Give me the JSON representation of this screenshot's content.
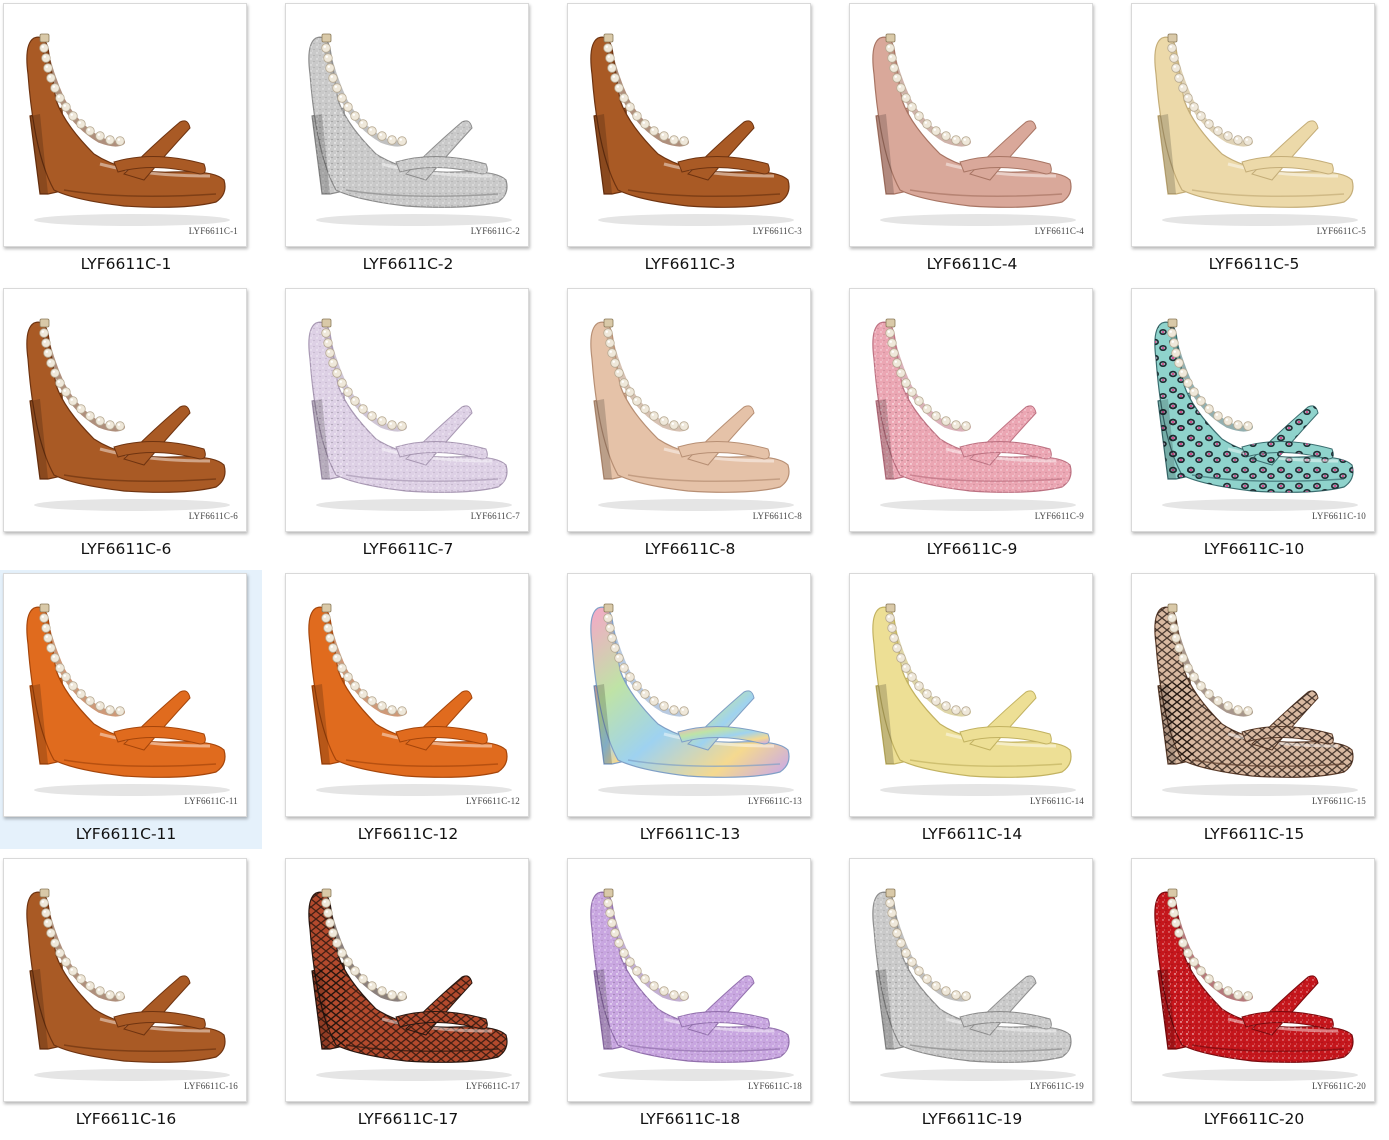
{
  "items": [
    {
      "label": "LYF6611C-1",
      "tag": "LYF6611C-1",
      "color": "#a95a25",
      "dark": "#6e3310",
      "pattern": "solid"
    },
    {
      "label": "LYF6611C-2",
      "tag": "LYF6611C-2",
      "color": "#c9c9c9",
      "dark": "#8c8c8c",
      "pattern": "glitter"
    },
    {
      "label": "LYF6611C-3",
      "tag": "LYF6611C-3",
      "color": "#a95a25",
      "dark": "#6e3310",
      "pattern": "solid"
    },
    {
      "label": "LYF6611C-4",
      "tag": "LYF6611C-4",
      "color": "#d9a89a",
      "dark": "#a87564",
      "pattern": "solid"
    },
    {
      "label": "LYF6611C-5",
      "tag": "LYF6611C-5",
      "color": "#ecd9a9",
      "dark": "#c4ad78",
      "pattern": "solid"
    },
    {
      "label": "LYF6611C-6",
      "tag": "LYF6611C-6",
      "color": "#a95a25",
      "dark": "#6e3310",
      "pattern": "solid"
    },
    {
      "label": "LYF6611C-7",
      "tag": "LYF6611C-7",
      "color": "#ddd0e5",
      "dark": "#a898b3",
      "pattern": "glitter"
    },
    {
      "label": "LYF6611C-8",
      "tag": "LYF6611C-8",
      "color": "#e5c2a8",
      "dark": "#b78f74",
      "pattern": "solid"
    },
    {
      "label": "LYF6611C-9",
      "tag": "LYF6611C-9",
      "color": "#eba6b3",
      "dark": "#bd7282",
      "pattern": "glitter"
    },
    {
      "label": "LYF6611C-10",
      "tag": "LYF6611C-10",
      "color": "#8fd3cc",
      "dark": "#3b6e70",
      "pattern": "leopard"
    },
    {
      "label": "LYF6611C-11",
      "tag": "LYF6611C-11",
      "color": "#e06b1e",
      "dark": "#a5450a",
      "pattern": "solid"
    },
    {
      "label": "LYF6611C-12",
      "tag": "LYF6611C-12",
      "color": "#e06b1e",
      "dark": "#a5450a",
      "pattern": "solid"
    },
    {
      "label": "LYF6611C-13",
      "tag": "LYF6611C-13",
      "color": "#b9b4e0",
      "dark": "#7f9fc6",
      "pattern": "holo"
    },
    {
      "label": "LYF6611C-14",
      "tag": "LYF6611C-14",
      "color": "#eddf95",
      "dark": "#c2b261",
      "pattern": "solid"
    },
    {
      "label": "LYF6611C-15",
      "tag": "LYF6611C-15",
      "color": "#d9b9a1",
      "dark": "#5e3f2d",
      "pattern": "snake"
    },
    {
      "label": "LYF6611C-16",
      "tag": "LYF6611C-16",
      "color": "#a95a25",
      "dark": "#6e3310",
      "pattern": "solid"
    },
    {
      "label": "LYF6611C-17",
      "tag": "LYF6611C-17",
      "color": "#b34a2d",
      "dark": "#2b1710",
      "pattern": "snake"
    },
    {
      "label": "LYF6611C-18",
      "tag": "LYF6611C-18",
      "color": "#c8a6e0",
      "dark": "#9270ad",
      "pattern": "glitter"
    },
    {
      "label": "LYF6611C-19",
      "tag": "LYF6611C-19",
      "color": "#c9c9c9",
      "dark": "#8c8c8c",
      "pattern": "glitter"
    },
    {
      "label": "LYF6611C-20",
      "tag": "LYF6611C-20",
      "color": "#c5161c",
      "dark": "#7a0a0e",
      "pattern": "glitter"
    }
  ],
  "selected_label": "LYF6611C-11"
}
